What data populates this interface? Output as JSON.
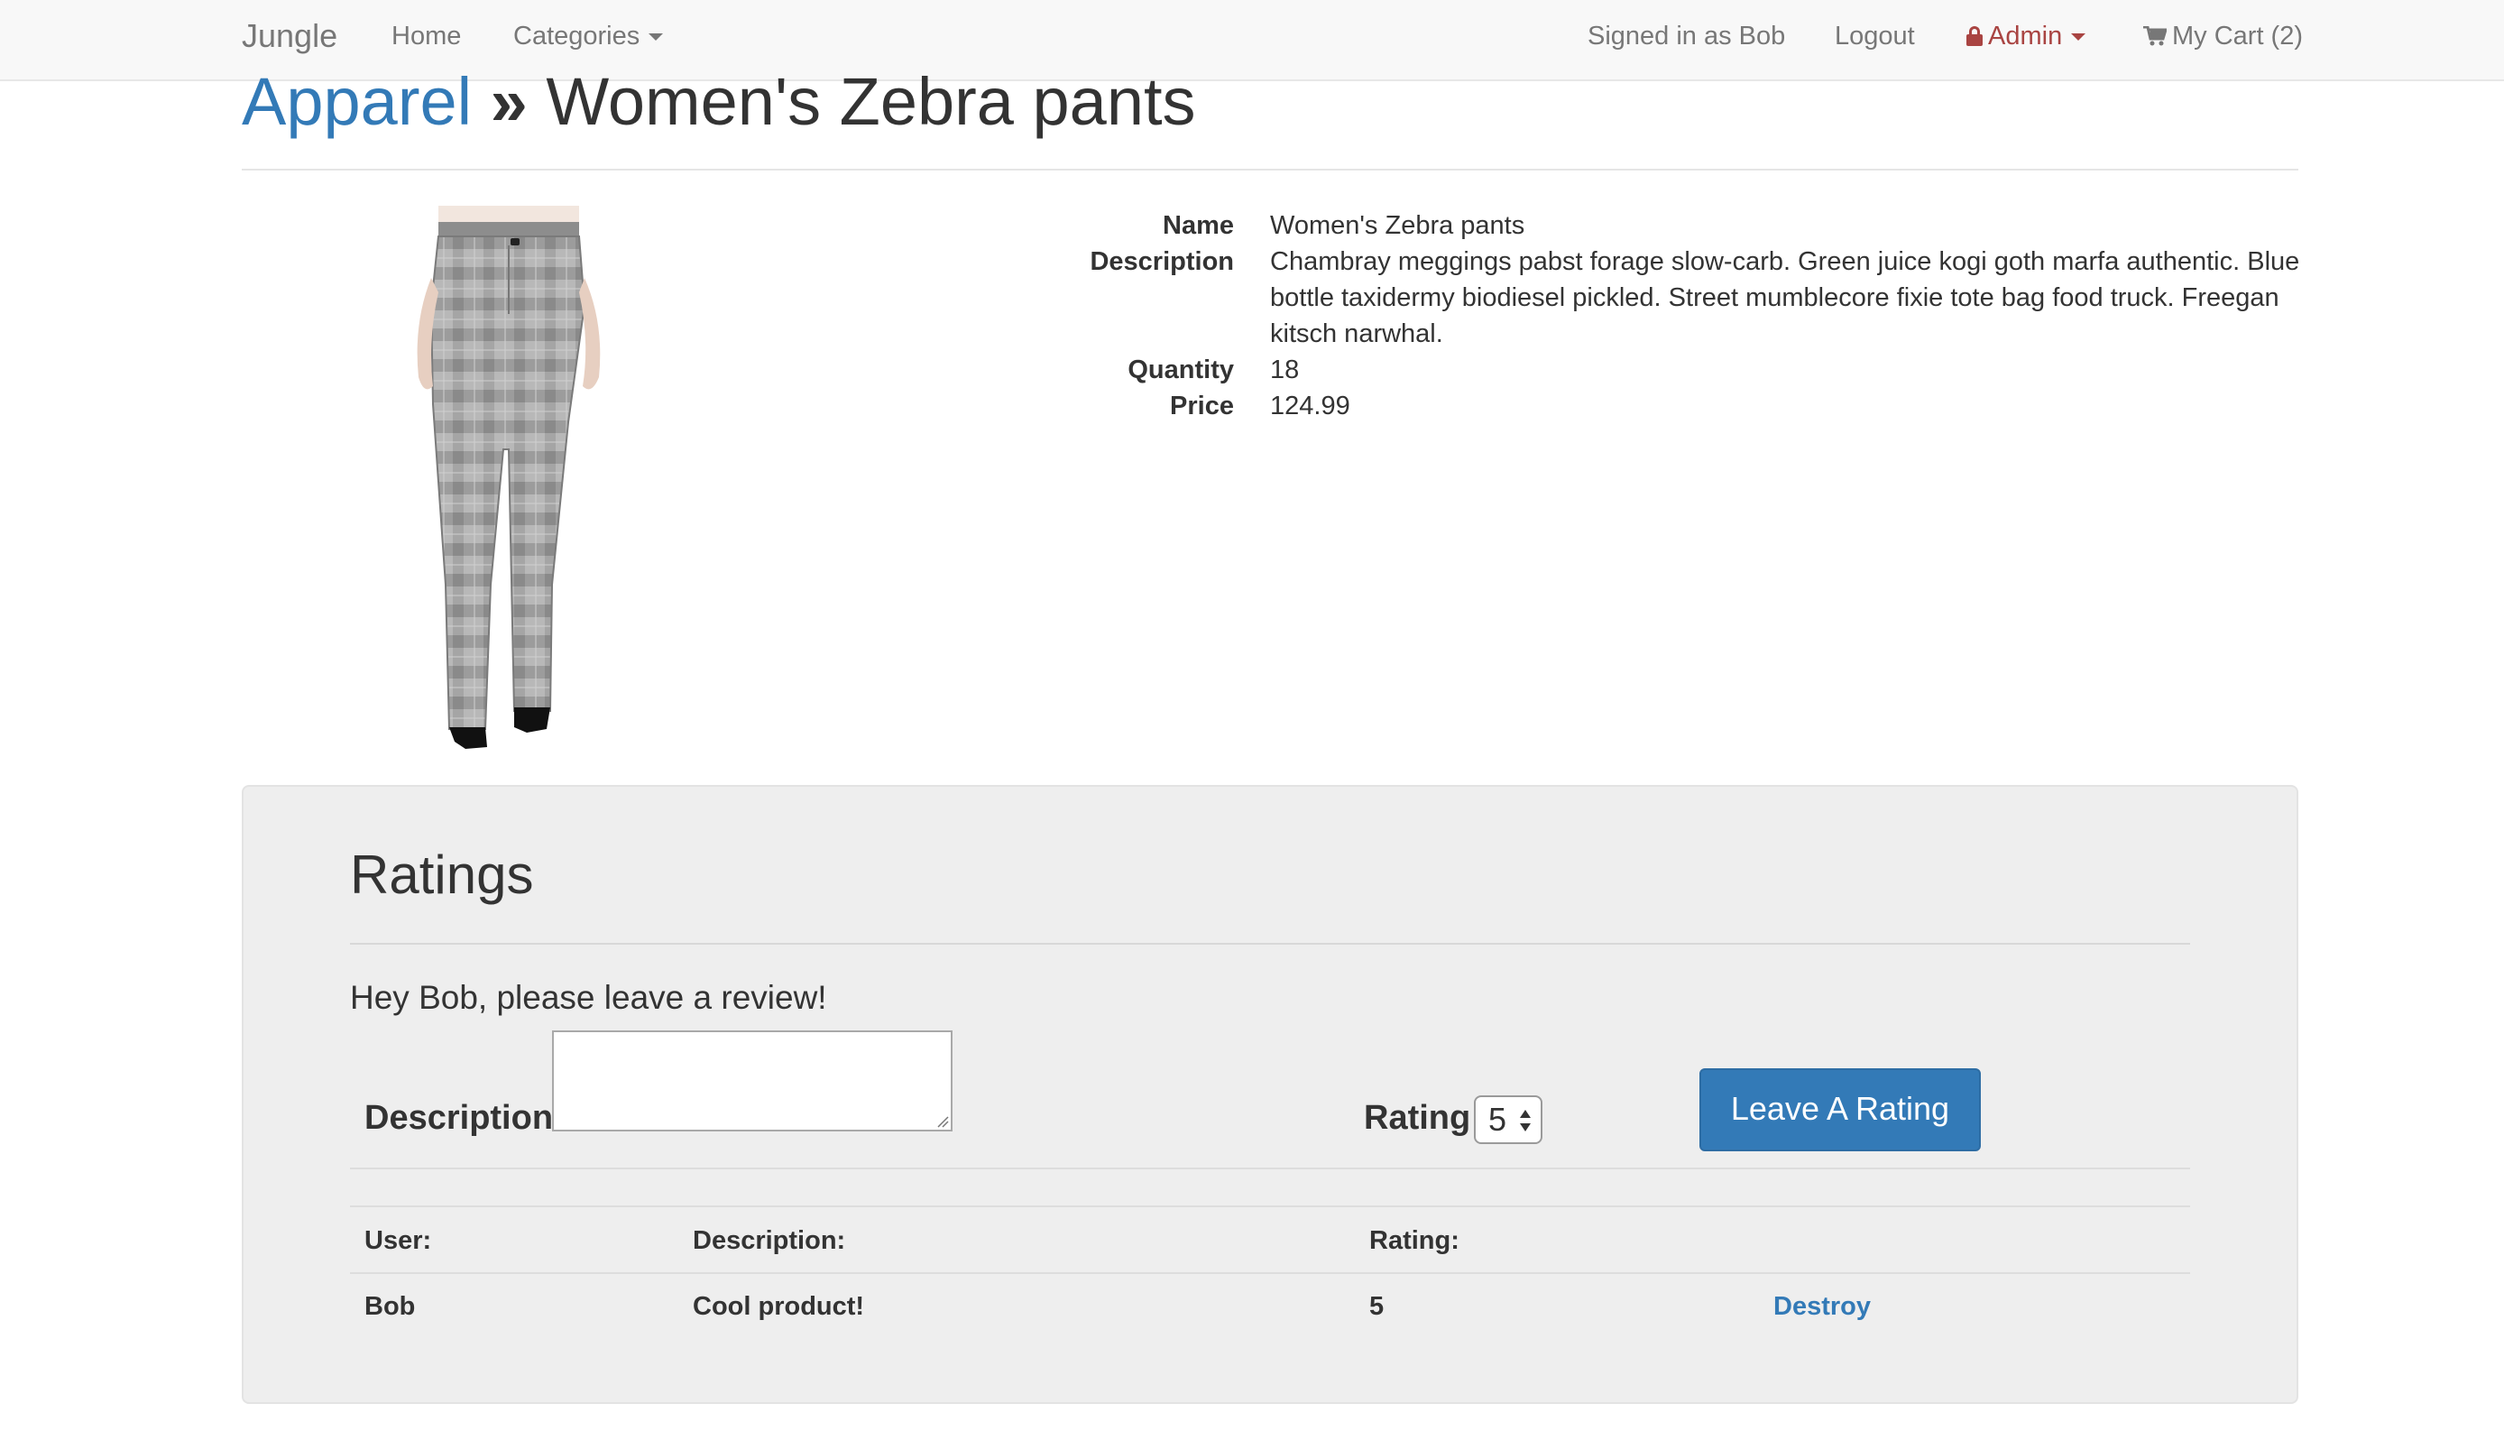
{
  "navbar": {
    "brand": "Jungle",
    "home": "Home",
    "categories": "Categories",
    "signed_in": "Signed in as Bob",
    "logout": "Logout",
    "admin": "Admin",
    "cart": "My Cart (2)"
  },
  "header": {
    "category": "Apparel",
    "separator": "»",
    "product_title": "Women's Zebra pants"
  },
  "product": {
    "name_label": "Name",
    "name": "Women's Zebra pants",
    "description_label": "Description",
    "description_lines": [
      "Chambray meggings pabst forage slow-carb. Green juice kogi goth marfa authentic. Blue",
      "bottle taxidermy biodiesel pickled. Street mumblecore fixie tote bag food truck. Freegan",
      "kitsch narwhal."
    ],
    "quantity_label": "Quantity",
    "quantity": "18",
    "price_label": "Price",
    "price": "124.99"
  },
  "ratings": {
    "title": "Ratings",
    "prompt": "Hey Bob, please leave a review!",
    "form": {
      "description_label": "Description",
      "description_value": "",
      "rating_label": "Rating",
      "rating_value": "5",
      "submit_label": "Leave A Rating"
    },
    "table": {
      "headers": [
        "User:",
        "Description:",
        "Rating:"
      ],
      "rows": [
        {
          "user": "Bob",
          "description": "Cool product!",
          "rating": "5",
          "action": "Destroy"
        }
      ]
    }
  }
}
